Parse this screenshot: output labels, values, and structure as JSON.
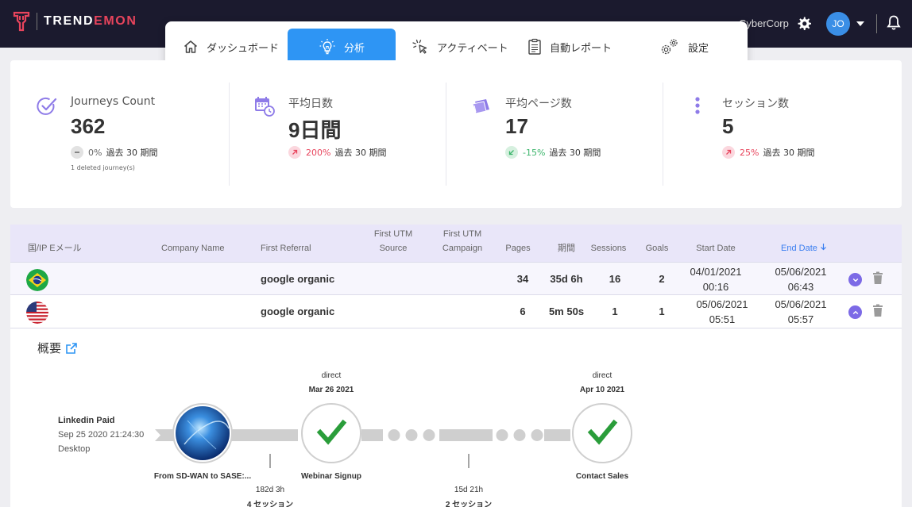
{
  "brand": {
    "name_part1": "TREND",
    "name_part2": "EMON"
  },
  "header": {
    "company": "CyberCorp",
    "avatar_initials": "JO"
  },
  "nav": [
    {
      "label": "ダッシュボード",
      "icon": "home-icon",
      "active": false
    },
    {
      "label": "分析",
      "icon": "lightbulb-icon",
      "active": true
    },
    {
      "label": "アクティベート",
      "icon": "cursor-click-icon",
      "active": false
    },
    {
      "label": "自動レポート",
      "icon": "report-icon",
      "active": false
    },
    {
      "label": "設定",
      "icon": "gears-icon",
      "active": false
    }
  ],
  "stats": [
    {
      "label": "Journeys Count",
      "value": "362",
      "pct": "0%",
      "period": "過去 30 期間",
      "trend": "neutral",
      "note": "1 deleted journey(s)"
    },
    {
      "label": "平均日数",
      "value": "9日間",
      "pct": "200%",
      "period": "過去 30 期間",
      "trend": "up"
    },
    {
      "label": "平均ページ数",
      "value": "17",
      "pct": "-15%",
      "period": "過去 30 期間",
      "trend": "down"
    },
    {
      "label": "セッション数",
      "value": "5",
      "pct": "25%",
      "period": "過去 30 期間",
      "trend": "up"
    }
  ],
  "table": {
    "headers": {
      "country_email": "国/IP Eメール",
      "company": "Company Name",
      "referral": "First Referral",
      "utm_source_1": "First UTM",
      "utm_source_2": "Source",
      "utm_campaign_1": "First UTM",
      "utm_campaign_2": "Campaign",
      "pages": "Pages",
      "period": "期間",
      "sessions": "Sessions",
      "goals": "Goals",
      "start": "Start Date",
      "end": "End Date"
    },
    "rows": [
      {
        "country": "Brazil",
        "referral": "google organic",
        "pages": "34",
        "period": "35d 6h",
        "sessions": "16",
        "goals": "2",
        "start_date": "04/01/2021",
        "start_time": "00:16",
        "end_date": "05/06/2021",
        "end_time": "06:43"
      },
      {
        "country": "United States",
        "referral": "google organic",
        "pages": "6",
        "period": "5m 50s",
        "sessions": "1",
        "goals": "1",
        "start_date": "05/06/2021",
        "start_time": "05:51",
        "end_date": "05/06/2021",
        "end_time": "05:57"
      }
    ]
  },
  "journey": {
    "overview_label": "概要",
    "source": {
      "name": "Linkedin Paid",
      "date": "Sep 25 2020 21:24:30",
      "device": "Desktop"
    },
    "nodes": [
      {
        "label": "From SD-WAN to SASE:..."
      },
      {
        "top1": "direct",
        "top2": "Mar 26 2021",
        "label": "Webinar Signup"
      },
      {
        "top1": "direct",
        "top2": "Apr 10 2021",
        "label": "Contact Sales"
      }
    ],
    "gaps": [
      {
        "duration": "182d 3h",
        "sessions": "4 セッション"
      },
      {
        "duration": "15d 21h",
        "sessions": "2 セッション"
      }
    ]
  }
}
